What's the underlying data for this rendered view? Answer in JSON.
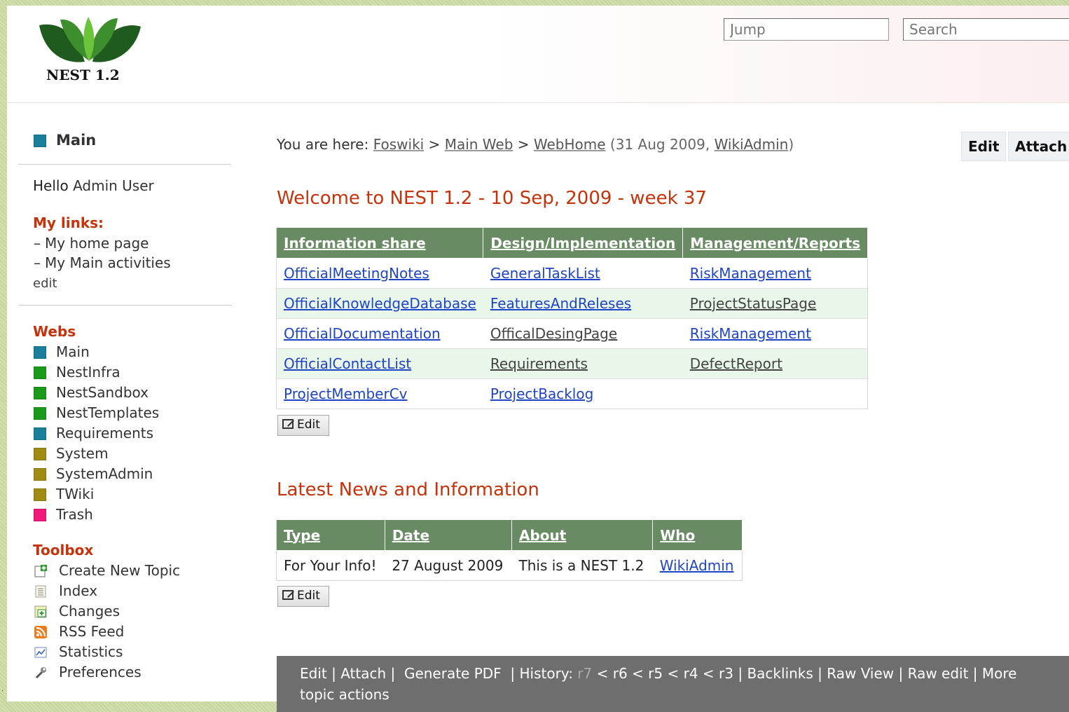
{
  "header": {
    "logo_text": "NEST 1.2",
    "jump_placeholder": "Jump",
    "search_placeholder": "Search"
  },
  "sidebar": {
    "web_name": "Main",
    "greeting_prefix": "Hello",
    "greeting_user": "Admin User",
    "my_links_title": "My links:",
    "my_links": [
      "My home page",
      "My Main activities"
    ],
    "edit_label": "edit",
    "webs_title": "Webs",
    "webs": [
      {
        "label": "Main",
        "color": "#1a7f9a"
      },
      {
        "label": "NestInfra",
        "color": "#1a9a1a"
      },
      {
        "label": "NestSandbox",
        "color": "#1a9a1a"
      },
      {
        "label": "NestTemplates",
        "color": "#1a9a1a"
      },
      {
        "label": "Requirements",
        "color": "#1a7f9a"
      },
      {
        "label": "System",
        "color": "#a08a12"
      },
      {
        "label": "SystemAdmin",
        "color": "#a08a12"
      },
      {
        "label": "TWiki",
        "color": "#a08a12"
      },
      {
        "label": "Trash",
        "color": "#f0187a"
      }
    ],
    "toolbox_title": "Toolbox",
    "toolbox": [
      {
        "label": "Create New Topic",
        "icon": "new-topic-icon"
      },
      {
        "label": "Index",
        "icon": "index-icon"
      },
      {
        "label": "Changes",
        "icon": "changes-icon"
      },
      {
        "label": "RSS Feed",
        "icon": "rss-icon"
      },
      {
        "label": "Statistics",
        "icon": "statistics-icon"
      },
      {
        "label": "Preferences",
        "icon": "preferences-icon"
      }
    ]
  },
  "breadcrumb": {
    "prefix": "You are here:",
    "items": [
      "Foswiki",
      "Main Web",
      "WebHome"
    ],
    "separator": ">",
    "meta_open": "(31 Aug 2009,",
    "meta_user": "WikiAdmin",
    "meta_close": ")"
  },
  "topbar": {
    "edit_label": "Edit",
    "attach_label": "Attach"
  },
  "welcome_title": "Welcome to NEST 1.2 - 10 Sep, 2009 - week 37",
  "links_table": {
    "headers": [
      "Information share",
      "Design/Implementation",
      "Management/Reports"
    ],
    "rows": [
      [
        "OfficialMeetingNotes",
        "GeneralTaskList",
        "RiskManagement"
      ],
      [
        "OfficialKnowledgeDatabase",
        "FeaturesAndReleses",
        "ProjectStatusPage"
      ],
      [
        "OfficialDocumentation",
        "OfficalDesingPage",
        "RiskManagement"
      ],
      [
        "OfficialContactList",
        "Requirements",
        "DefectReport"
      ],
      [
        "ProjectMemberCv",
        "ProjectBacklog",
        ""
      ]
    ]
  },
  "edit_button_label": "Edit",
  "news_title": "Latest News and Information",
  "news_table": {
    "headers": [
      "Type",
      "Date",
      "About",
      "Who"
    ],
    "rows": [
      [
        "For Your Info!",
        "27 August 2009",
        "This is a NEST 1.2",
        "WikiAdmin"
      ]
    ]
  },
  "footer": {
    "edit": "Edit",
    "attach": "Attach",
    "generate_pdf": "Generate PDF",
    "history": "History:",
    "revisions": [
      "r7",
      "r6",
      "r5",
      "r4",
      "r3"
    ],
    "backlinks": "Backlinks",
    "raw_view": "Raw View",
    "raw_edit": "Raw edit",
    "more": "More topic actions"
  },
  "stray_mark": "."
}
